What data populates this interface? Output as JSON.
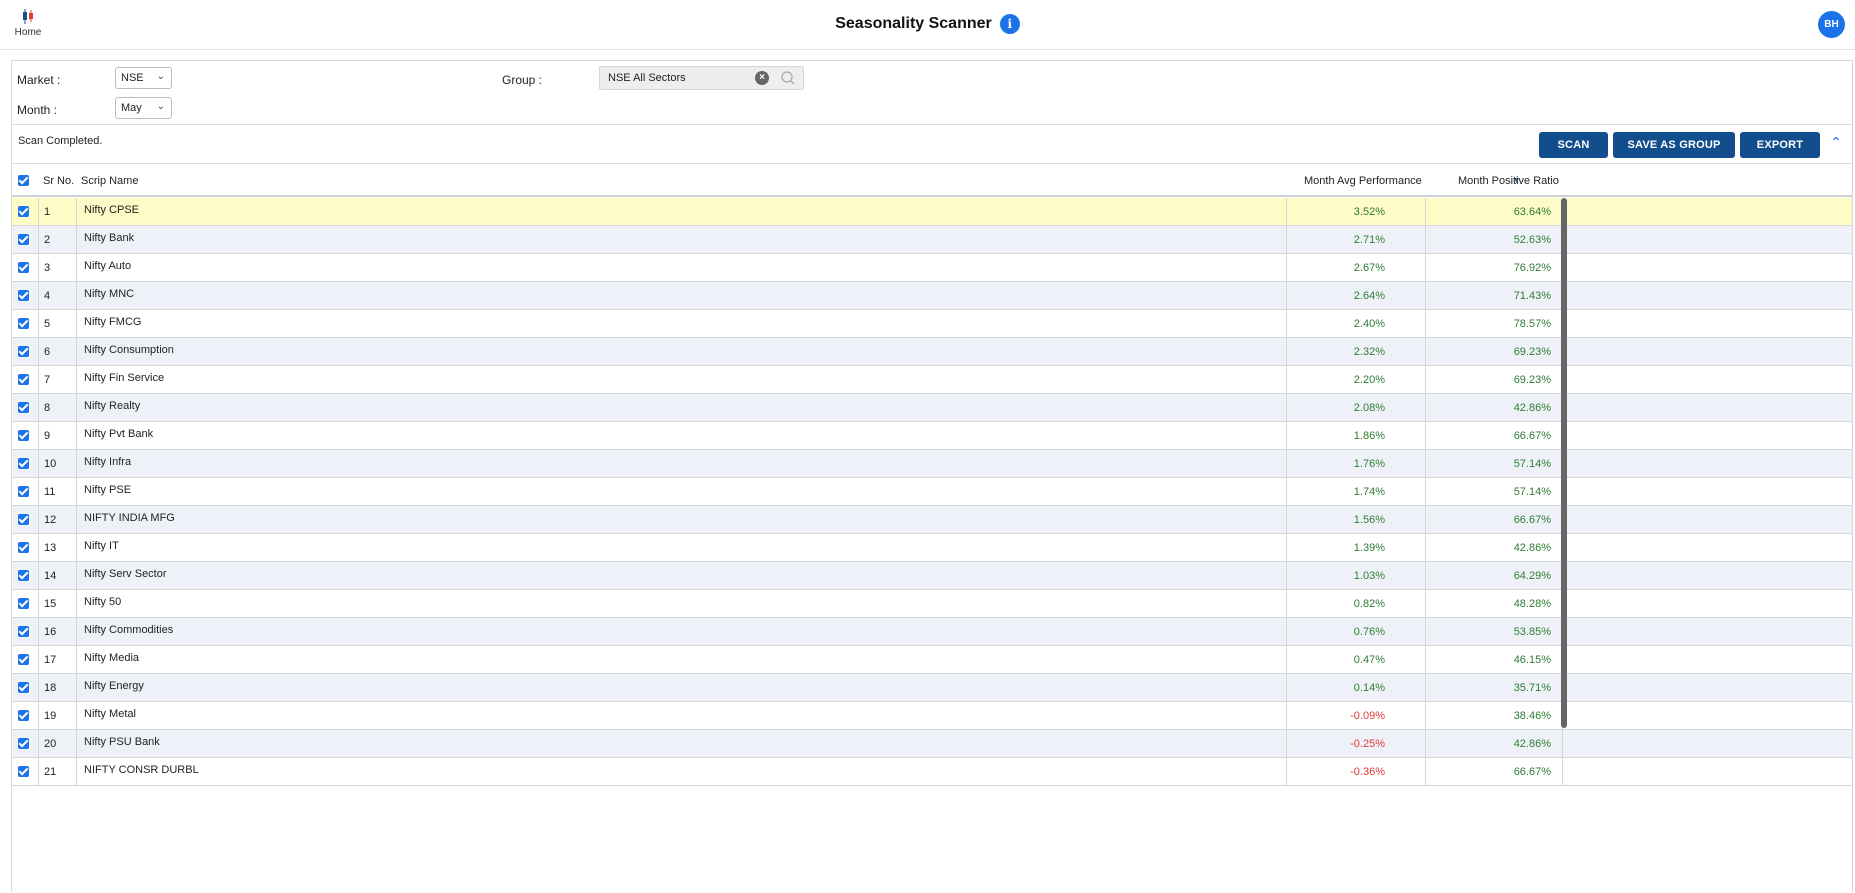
{
  "header": {
    "home_label": "Home",
    "title": "Seasonality Scanner",
    "info_icon": "i",
    "avatar_initials": "BH"
  },
  "filters": {
    "market_label": "Market :",
    "market_value": "NSE",
    "month_label": "Month :",
    "month_value": "May",
    "group_label": "Group :",
    "group_value": "NSE All Sectors"
  },
  "status": {
    "text": "Scan Completed.",
    "scan_label": "SCAN",
    "save_group_label": "SAVE AS GROUP",
    "export_label": "EXPORT"
  },
  "table": {
    "headers": {
      "sr": "Sr No.",
      "name": "Scrip Name",
      "avg": "Month Avg Performance",
      "ratio": "Month Positive Ratio"
    },
    "rows": [
      {
        "sr": "1",
        "name": "Nifty CPSE",
        "avg": "3.52%",
        "ratio": "63.64%"
      },
      {
        "sr": "2",
        "name": "Nifty Bank",
        "avg": "2.71%",
        "ratio": "52.63%"
      },
      {
        "sr": "3",
        "name": "Nifty Auto",
        "avg": "2.67%",
        "ratio": "76.92%"
      },
      {
        "sr": "4",
        "name": "Nifty MNC",
        "avg": "2.64%",
        "ratio": "71.43%"
      },
      {
        "sr": "5",
        "name": "Nifty FMCG",
        "avg": "2.40%",
        "ratio": "78.57%"
      },
      {
        "sr": "6",
        "name": "Nifty Consumption",
        "avg": "2.32%",
        "ratio": "69.23%"
      },
      {
        "sr": "7",
        "name": "Nifty Fin Service",
        "avg": "2.20%",
        "ratio": "69.23%"
      },
      {
        "sr": "8",
        "name": "Nifty Realty",
        "avg": "2.08%",
        "ratio": "42.86%"
      },
      {
        "sr": "9",
        "name": "Nifty Pvt Bank",
        "avg": "1.86%",
        "ratio": "66.67%"
      },
      {
        "sr": "10",
        "name": "Nifty Infra",
        "avg": "1.76%",
        "ratio": "57.14%"
      },
      {
        "sr": "11",
        "name": "Nifty PSE",
        "avg": "1.74%",
        "ratio": "57.14%"
      },
      {
        "sr": "12",
        "name": "NIFTY INDIA MFG",
        "avg": "1.56%",
        "ratio": "66.67%"
      },
      {
        "sr": "13",
        "name": "Nifty IT",
        "avg": "1.39%",
        "ratio": "42.86%"
      },
      {
        "sr": "14",
        "name": "Nifty Serv Sector",
        "avg": "1.03%",
        "ratio": "64.29%"
      },
      {
        "sr": "15",
        "name": "Nifty 50",
        "avg": "0.82%",
        "ratio": "48.28%"
      },
      {
        "sr": "16",
        "name": "Nifty Commodities",
        "avg": "0.76%",
        "ratio": "53.85%"
      },
      {
        "sr": "17",
        "name": "Nifty Media",
        "avg": "0.47%",
        "ratio": "46.15%"
      },
      {
        "sr": "18",
        "name": "Nifty Energy",
        "avg": "0.14%",
        "ratio": "35.71%"
      },
      {
        "sr": "19",
        "name": "Nifty Metal",
        "avg": "-0.09%",
        "ratio": "38.46%"
      },
      {
        "sr": "20",
        "name": "Nifty PSU Bank",
        "avg": "-0.25%",
        "ratio": "42.86%"
      },
      {
        "sr": "21",
        "name": "NIFTY CONSR DURBL",
        "avg": "-0.36%",
        "ratio": "66.67%"
      }
    ]
  },
  "colors": {
    "accent": "#124e8c",
    "positive": "#2e7d32",
    "negative": "#e53935",
    "selected_row": "#fdfcc6"
  }
}
